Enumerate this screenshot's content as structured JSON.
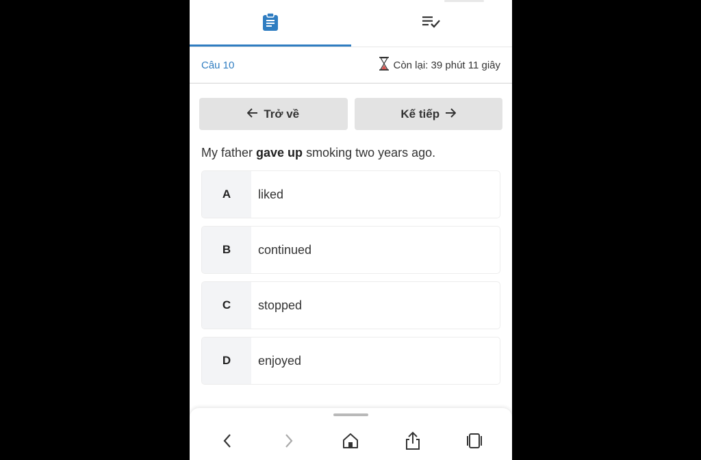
{
  "header": {
    "tabs": [
      {
        "icon": "clipboard-icon",
        "active": true
      },
      {
        "icon": "checklist-icon",
        "active": false
      }
    ]
  },
  "status": {
    "question_label": "Câu 10",
    "timer_text": "Còn lại: 39 phút 11 giây",
    "timer_icon": "hourglass-icon"
  },
  "nav": {
    "back_label": "Trở về",
    "next_label": "Kế tiếp"
  },
  "question": {
    "before": "My father ",
    "highlight": "gave up",
    "after": " smoking two years ago."
  },
  "options": [
    {
      "letter": "A",
      "text": "liked"
    },
    {
      "letter": "B",
      "text": "continued"
    },
    {
      "letter": "C",
      "text": "stopped"
    },
    {
      "letter": "D",
      "text": "enjoyed"
    }
  ],
  "browser_bar": {
    "icons": [
      "back-icon",
      "forward-icon",
      "home-icon",
      "share-icon",
      "tabs-icon"
    ]
  },
  "colors": {
    "accent": "#2f7dc1",
    "button_bg": "#e3e3e3",
    "letter_bg": "#f3f4f6"
  }
}
